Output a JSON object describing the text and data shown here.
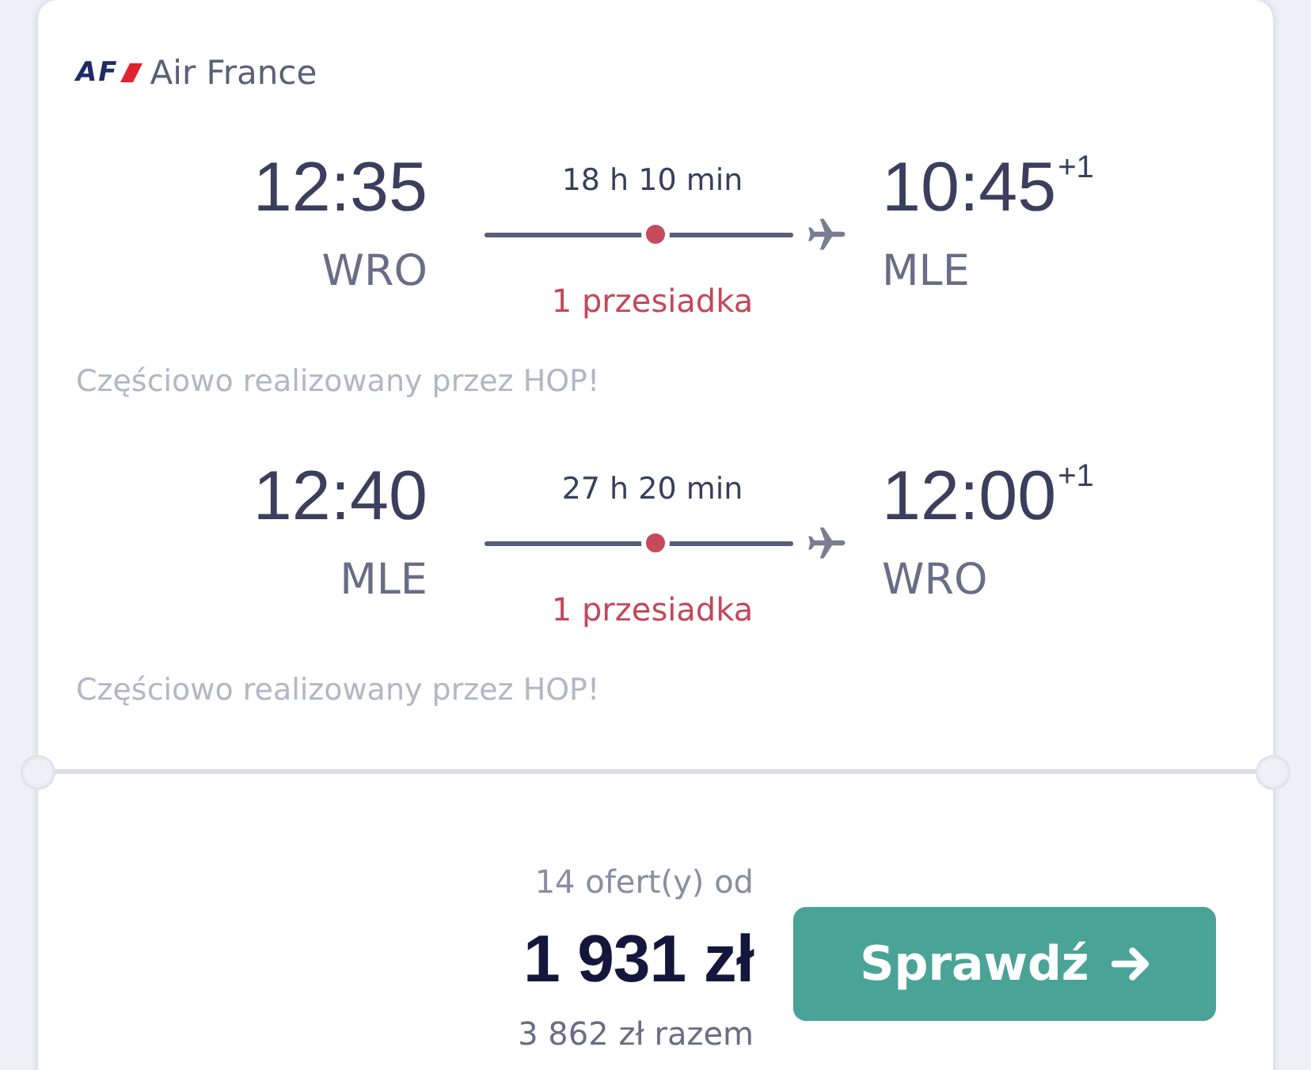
{
  "airline": {
    "logo_text": "AF",
    "name": "Air France"
  },
  "legs": [
    {
      "departure": {
        "time": "12:35",
        "airport": "WRO"
      },
      "duration": "18 h 10 min",
      "stops": "1 przesiadka",
      "arrival": {
        "time": "10:45",
        "day_offset": "+1",
        "airport": "MLE"
      },
      "note": "Częściowo realizowany przez HOP!"
    },
    {
      "departure": {
        "time": "12:40",
        "airport": "MLE"
      },
      "duration": "27 h 20 min",
      "stops": "1 przesiadka",
      "arrival": {
        "time": "12:00",
        "day_offset": "+1",
        "airport": "WRO"
      },
      "note": "Częściowo realizowany przez HOP!"
    }
  ],
  "price": {
    "offers": "14 ofert(y) od",
    "amount": "1 931 zł",
    "total": "3 862 zł razem"
  },
  "action": {
    "label": "Sprawdź"
  }
}
